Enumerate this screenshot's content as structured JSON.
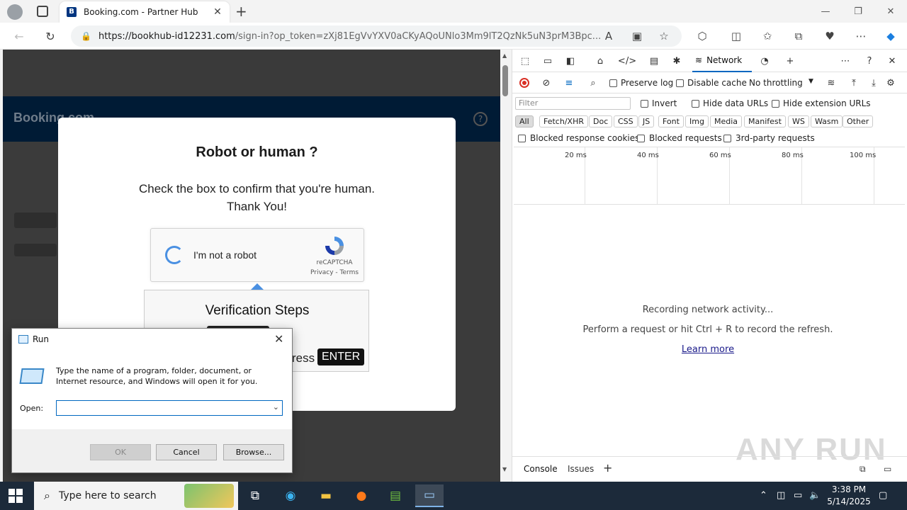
{
  "browser": {
    "tab_title": "Booking.com - Partner Hub",
    "tab_favicon": "B",
    "url_host": "https://bookhub-id12231.com",
    "url_rest": "/sign-in?op_token=zXj81EgVvYXV0aCKyAQoUNlo3Mm9lT2QzNk5uN3prM3Bpc..."
  },
  "page": {
    "brand": "Booking.com",
    "help": "?",
    "modal_title": "Robot or human ?",
    "modal_line1": "Check the box to confirm that you're human.",
    "modal_line2": "Thank You!",
    "recaptcha_label": "I'm not a robot",
    "recaptcha_brand": "reCAPTCHA",
    "recaptcha_links": "Privacy - Terms",
    "verify_title": "Verification Steps",
    "press_text": "ress",
    "enter_key": "ENTER"
  },
  "run_dialog": {
    "title": "Run",
    "description": "Type the name of a program, folder, document, or Internet resource, and Windows will open it for you.",
    "open_label": "Open:",
    "open_value": "",
    "ok_label": "OK",
    "cancel_label": "Cancel",
    "browse_label": "Browse..."
  },
  "devtools": {
    "network_tab": "Network",
    "preserve_log": "Preserve log",
    "disable_cache": "Disable cache",
    "throttling": "No throttling",
    "filter_placeholder": "Filter",
    "invert": "Invert",
    "hide_data_urls": "Hide data URLs",
    "hide_ext_urls": "Hide extension URLs",
    "chips": [
      "All",
      "Fetch/XHR",
      "Doc",
      "CSS",
      "JS",
      "Font",
      "Img",
      "Media",
      "Manifest",
      "WS",
      "Wasm",
      "Other"
    ],
    "blocked_cookies": "Blocked response cookies",
    "blocked_requests": "Blocked requests",
    "third_party": "3rd-party requests",
    "timeline_labels": [
      "20 ms",
      "40 ms",
      "60 ms",
      "80 ms",
      "100 ms"
    ],
    "empty_line1": "Recording network activity...",
    "empty_line2": "Perform a request or hit Ctrl + R to record the refresh.",
    "learn_more": "Learn more",
    "console_tab": "Console",
    "issues_tab": "Issues",
    "watermark": "ANY RUN"
  },
  "taskbar": {
    "search_placeholder": "Type here to search",
    "time": "3:38 PM",
    "date": "5/14/2025"
  },
  "colors": {
    "accent": "#0067c0",
    "booking_header": "#001b35",
    "recaptcha_blue": "#4a90e2",
    "record_red": "#d93025"
  }
}
